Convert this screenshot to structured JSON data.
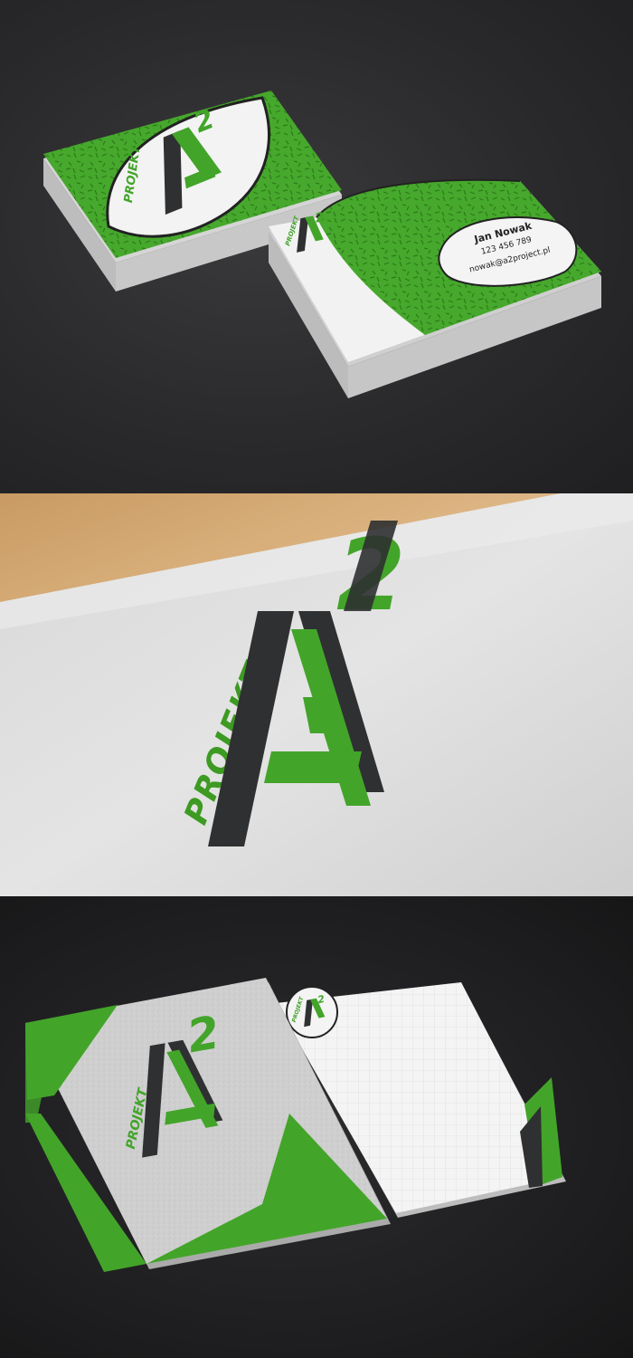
{
  "brand": {
    "word": "PROJEKT",
    "letter": "A",
    "superscript": "2",
    "colors": {
      "green": "#43a42a",
      "dark": "#2f3031",
      "paper": "#f2f2f2",
      "grey": "#c9c9c9"
    }
  },
  "card": {
    "name": "Jan Nowak",
    "phone": "123 456 789",
    "email": "nowak@a2project.pl"
  }
}
